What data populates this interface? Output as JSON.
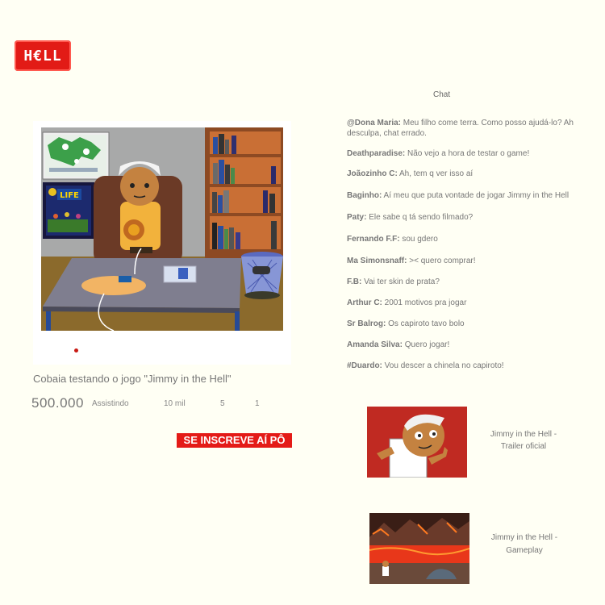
{
  "logo": {
    "text": "H€LL"
  },
  "video": {
    "title": "Cobaia testando o jogo \"Jimmy in the Hell\"",
    "views": "500.000",
    "watching_label": "Assistindo",
    "likes": "10 mil",
    "comments": "5",
    "shares": "1",
    "subscribe_label": "SE INSCREVE AÍ PÔ",
    "poster_text": "LIFE"
  },
  "chat": {
    "title": "Chat",
    "messages": [
      {
        "author": "@Dona Maria:",
        "text": " Meu filho come terra. Como posso ajudá-lo? Ah desculpa, chat errado."
      },
      {
        "author": "Deathparadise:",
        "text": " Não vejo a hora de testar o game!"
      },
      {
        "author": "Joãozinho C:",
        "text": " Ah, tem q ver isso aí"
      },
      {
        "author": "Baginho:",
        "text": " Aí meu que puta vontade de jogar Jimmy in the Hell"
      },
      {
        "author": "Paty:",
        "text": " Ele sabe q tá sendo filmado?"
      },
      {
        "author": "Fernando F.F:",
        "text": " sou gdero"
      },
      {
        "author": "Ma Simonsnaff:",
        "text": " >< quero comprar!"
      },
      {
        "author": "F.B:",
        "text": " Vai ter skin de prata?"
      },
      {
        "author": "Arthur C:",
        "text": " 2001 motivos pra jogar"
      },
      {
        "author": "Sr Balrog:",
        "text": " Os capiroto tavo bolo"
      },
      {
        "author": "Amanda Silva:",
        "text": " Quero jogar!"
      },
      {
        "author": "#Duardo:",
        "text": " Vou descer a chinela no capiroto!"
      }
    ]
  },
  "related": [
    {
      "title": "Jimmy in the Hell - Trailer oficial"
    },
    {
      "title": "Jimmy in the Hell - Gameplay"
    }
  ],
  "colors": {
    "brand_red": "#e21b16",
    "background": "#fffff4"
  }
}
